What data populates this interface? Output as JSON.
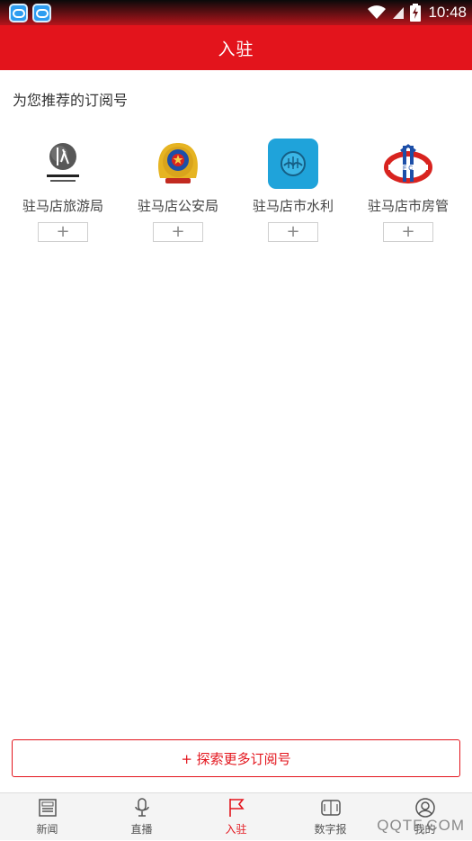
{
  "status_bar": {
    "time": "10:48",
    "left_icons": [
      "app-notification-icon",
      "app-notification-icon"
    ],
    "right_icons": [
      "wifi-icon",
      "signal-icon",
      "battery-charging-icon"
    ]
  },
  "header": {
    "title": "入驻"
  },
  "recommend": {
    "title": "为您推荐的订阅号",
    "items": [
      {
        "name": "驻马店旅游局",
        "add_label": "+",
        "logo": "tourism-logo"
      },
      {
        "name": "驻马店公安局",
        "add_label": "+",
        "logo": "police-emblem"
      },
      {
        "name": "驻马店市水利",
        "add_label": "+",
        "logo": "water-resources-logo"
      },
      {
        "name": "驻马店市房管",
        "add_label": "+",
        "logo": "housing-management-logo"
      }
    ]
  },
  "explore_button": {
    "label": "+ 探索更多订阅号"
  },
  "tabs": [
    {
      "label": "新闻",
      "icon": "newspaper-icon",
      "active": false
    },
    {
      "label": "直播",
      "icon": "microphone-icon",
      "active": false
    },
    {
      "label": "入驻",
      "icon": "flag-icon",
      "active": true
    },
    {
      "label": "数字报",
      "icon": "digital-paper-icon",
      "active": false
    },
    {
      "label": "我的",
      "icon": "user-icon",
      "active": false
    }
  ],
  "watermark": "QQTF.COM",
  "colors": {
    "brand_red": "#e3141c",
    "text": "#333333",
    "tab_inactive": "#555555"
  }
}
